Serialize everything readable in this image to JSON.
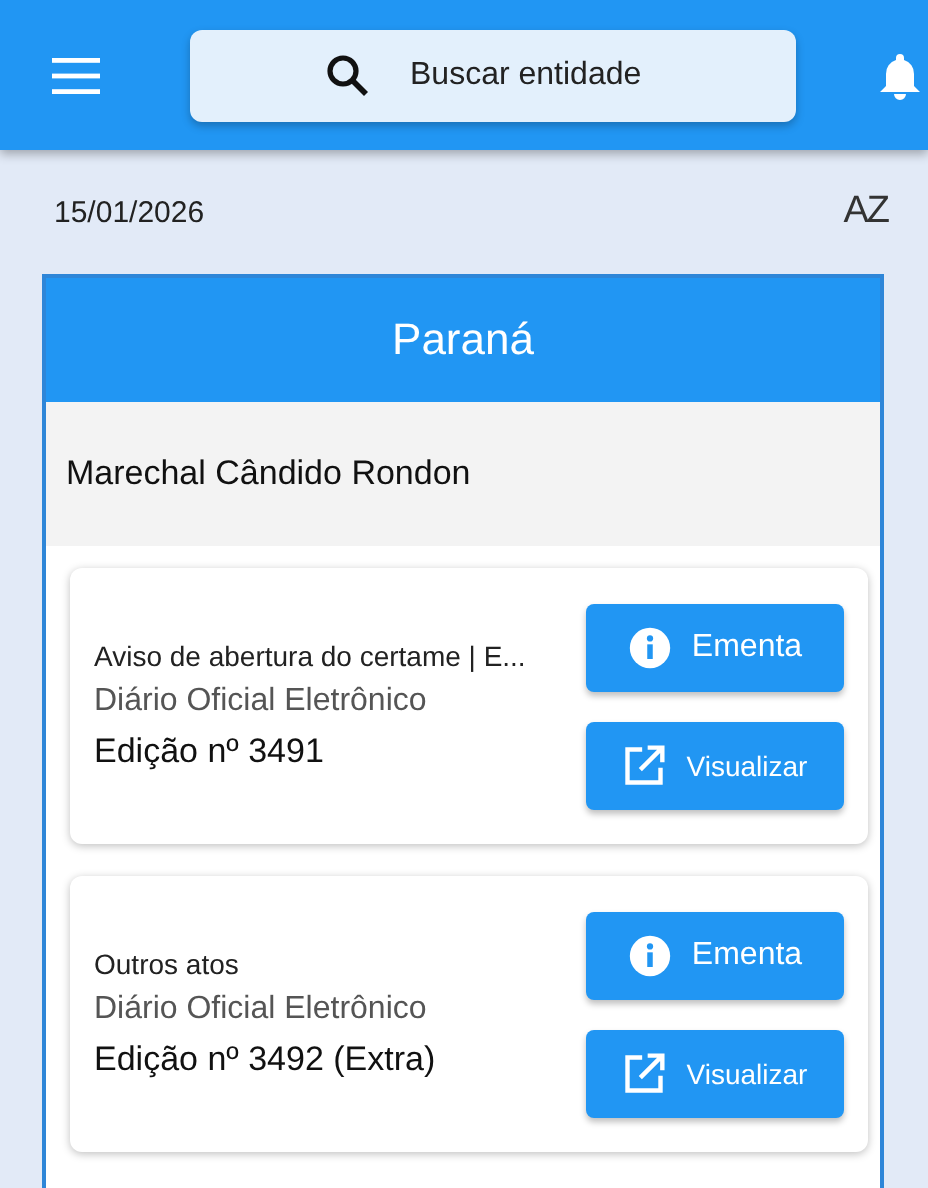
{
  "search": {
    "placeholder": "Buscar entidade"
  },
  "date": "15/01/2026",
  "sort_label": "AZ",
  "state": "Paraná",
  "city": "Marechal Cândido Rondon",
  "items": [
    {
      "title": "Aviso de abertura do certame | E...",
      "source": "Diário Oficial Eletrônico",
      "edition": "Edição nº 3491",
      "buttons": [
        "Ementa",
        "Visualizar"
      ]
    },
    {
      "title": "Outros atos",
      "source": "Diário Oficial Eletrônico",
      "edition": "Edição nº 3492 (Extra)",
      "buttons": [
        "Ementa",
        "Visualizar"
      ]
    }
  ]
}
